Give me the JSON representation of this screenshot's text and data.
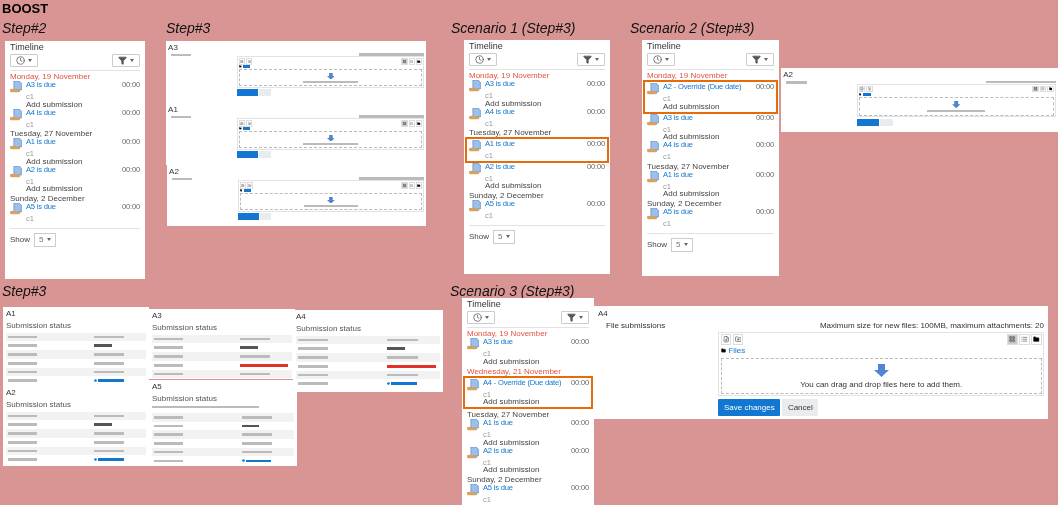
{
  "heading": "BOOST",
  "groups": [
    {
      "caption": "Step#2",
      "panels": [
        {
          "kind": "timeline",
          "title": "Timeline",
          "days": [
            {
              "date": "Monday, 19 November",
              "past": true,
              "events": [
                {
                  "name": "A3 is due",
                  "course": "c1",
                  "time": "00:00",
                  "action": "Add submission",
                  "highlighted": false
                },
                {
                  "name": "A4 is due",
                  "course": "c1",
                  "time": "00:00",
                  "highlighted": false
                }
              ]
            },
            {
              "date": "Tuesday, 27 November",
              "past": false,
              "events": [
                {
                  "name": "A1 is due",
                  "course": "c1",
                  "time": "00:00",
                  "action": "Add submission",
                  "highlighted": false
                },
                {
                  "name": "A2 is due",
                  "course": "c1",
                  "time": "00:00",
                  "action": "Add submission",
                  "highlighted": false
                }
              ]
            },
            {
              "date": "Sunday, 2 December",
              "past": false,
              "events": [
                {
                  "name": "A5 is due",
                  "course": "c1",
                  "time": "00:00",
                  "highlighted": false
                }
              ]
            }
          ],
          "show_label": "Show",
          "show_value": "5"
        }
      ]
    },
    {
      "caption": "Step#3",
      "panels": [
        {
          "kind": "file_submission",
          "title": "A3"
        },
        {
          "kind": "file_submission",
          "title": "A1"
        },
        {
          "kind": "file_submission",
          "title": "A2"
        }
      ]
    },
    {
      "caption": "Scenario 1 (Step#3)",
      "panels": [
        {
          "kind": "timeline",
          "title": "Timeline",
          "days": [
            {
              "date": "Monday, 19 November",
              "past": true,
              "events": [
                {
                  "name": "A3 is due",
                  "course": "c1",
                  "time": "00:00",
                  "action": "Add submission",
                  "highlighted": false
                },
                {
                  "name": "A4 is due",
                  "course": "c1",
                  "time": "00:00",
                  "highlighted": false
                }
              ]
            },
            {
              "date": "Tuesday, 27 November",
              "past": false,
              "events": [
                {
                  "name": "A1 is due",
                  "course": "c1",
                  "time": "00:00",
                  "highlighted": true
                },
                {
                  "name": "A2 is due",
                  "course": "c1",
                  "time": "00:00",
                  "action": "Add submission",
                  "highlighted": false
                }
              ]
            },
            {
              "date": "Sunday, 2 December",
              "past": false,
              "events": [
                {
                  "name": "A5 is due",
                  "course": "c1",
                  "time": "00:00",
                  "highlighted": false
                }
              ]
            }
          ],
          "show_label": "Show",
          "show_value": "5"
        }
      ]
    },
    {
      "caption": "Scenario 2 (Step#3)",
      "panels": [
        {
          "kind": "timeline",
          "title": "Timeline",
          "days": [
            {
              "date": "Monday, 19 November",
              "past": true,
              "events": [
                {
                  "name": "A2 - Override (Due date)",
                  "course": "c1",
                  "time": "00:00",
                  "action": "Add submission",
                  "highlighted": true
                },
                {
                  "name": "A3 is due",
                  "course": "c1",
                  "time": "00:00",
                  "action": "Add submission",
                  "highlighted": false
                },
                {
                  "name": "A4 is due",
                  "course": "c1",
                  "time": "00:00",
                  "highlighted": false
                }
              ]
            },
            {
              "date": "Tuesday, 27 November",
              "past": false,
              "events": [
                {
                  "name": "A1 is due",
                  "course": "c1",
                  "time": "00:00",
                  "action": "Add submission",
                  "highlighted": false
                }
              ]
            },
            {
              "date": "Sunday, 2 December",
              "past": false,
              "events": [
                {
                  "name": "A5 is due",
                  "course": "c1",
                  "time": "00:00",
                  "highlighted": false
                }
              ]
            }
          ],
          "show_label": "Show",
          "show_value": "5"
        },
        {
          "kind": "file_submission",
          "title": "A2"
        }
      ]
    },
    {
      "caption": "Step#3",
      "panels": [
        {
          "kind": "submission_status",
          "title": "A1",
          "heading": "Submission status",
          "rows": [
            {
              "kind": "plain"
            },
            {
              "kind": "bold"
            },
            {
              "kind": "plain"
            },
            {
              "kind": "plain"
            },
            {
              "kind": "plain"
            },
            {
              "kind": "link"
            }
          ]
        },
        {
          "kind": "submission_status",
          "title": "A3",
          "heading": "Submission status",
          "rows": [
            {
              "kind": "plain"
            },
            {
              "kind": "bold"
            },
            {
              "kind": "plain"
            },
            {
              "kind": "alert"
            },
            {
              "kind": "plain"
            }
          ]
        },
        {
          "kind": "submission_status",
          "title": "A4",
          "heading": "Submission status",
          "rows": [
            {
              "kind": "plain"
            },
            {
              "kind": "bold"
            },
            {
              "kind": "plain"
            },
            {
              "kind": "alert"
            },
            {
              "kind": "plain"
            },
            {
              "kind": "link"
            }
          ]
        },
        {
          "kind": "submission_status",
          "title": "A2",
          "heading": "Submission status",
          "rows": [
            {
              "kind": "plain"
            },
            {
              "kind": "bold"
            },
            {
              "kind": "plain"
            },
            {
              "kind": "plain"
            },
            {
              "kind": "plain"
            },
            {
              "kind": "link"
            }
          ]
        },
        {
          "kind": "submission_status",
          "title": "A5",
          "heading": "Submission status",
          "notice": true,
          "rows": [
            {
              "kind": "plain"
            },
            {
              "kind": "bold"
            },
            {
              "kind": "plain"
            },
            {
              "kind": "plain"
            },
            {
              "kind": "plain"
            },
            {
              "kind": "link"
            }
          ]
        }
      ]
    },
    {
      "caption": "Scenario 3 (Step#3)",
      "panels": [
        {
          "kind": "timeline",
          "title": "Timeline",
          "days": [
            {
              "date": "Monday, 19 November",
              "past": true,
              "events": [
                {
                  "name": "A3 is due",
                  "course": "c1",
                  "time": "00:00",
                  "action": "Add submission",
                  "highlighted": false
                }
              ]
            },
            {
              "date": "Wednesday, 21 November",
              "past": true,
              "events": [
                {
                  "name": "A4 - Override (Due date)",
                  "course": "c1",
                  "time": "00:00",
                  "action": "Add submission",
                  "highlighted": true
                }
              ]
            },
            {
              "date": "Tuesday, 27 November",
              "past": false,
              "events": [
                {
                  "name": "A1 is due",
                  "course": "c1",
                  "time": "00:00",
                  "action": "Add submission",
                  "highlighted": false
                },
                {
                  "name": "A2 is due",
                  "course": "c1",
                  "time": "00:00",
                  "action": "Add submission",
                  "highlighted": false
                }
              ]
            },
            {
              "date": "Sunday, 2 December",
              "past": false,
              "events": [
                {
                  "name": "A5 is due",
                  "course": "c1",
                  "time": "00:00",
                  "highlighted": false
                }
              ]
            }
          ]
        },
        {
          "kind": "file_submission",
          "title": "A4",
          "field_label": "File submissions",
          "limits": "Maximum size for new files: 100MB, maximum attachments: 20",
          "path": "Files",
          "drop_hint": "You can drag and drop files here to add them.",
          "buttons": [
            "Save changes",
            "Cancel"
          ]
        }
      ]
    }
  ]
}
